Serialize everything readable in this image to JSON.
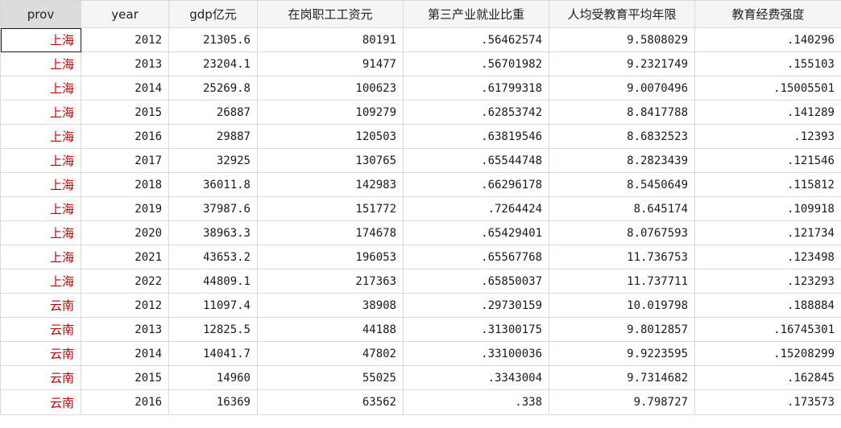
{
  "columns": [
    "prov",
    "year",
    "gdp亿元",
    "在岗职工工资元",
    "第三产业就业比重",
    "人均受教育平均年限",
    "教育经费强度"
  ],
  "rows": [
    [
      "上海",
      "2012",
      "21305.6",
      "80191",
      ".56462574",
      "9.5808029",
      ".140296"
    ],
    [
      "上海",
      "2013",
      "23204.1",
      "91477",
      ".56701982",
      "9.2321749",
      ".155103"
    ],
    [
      "上海",
      "2014",
      "25269.8",
      "100623",
      ".61799318",
      "9.0070496",
      ".15005501"
    ],
    [
      "上海",
      "2015",
      "26887",
      "109279",
      ".62853742",
      "8.8417788",
      ".141289"
    ],
    [
      "上海",
      "2016",
      "29887",
      "120503",
      ".63819546",
      "8.6832523",
      ".12393"
    ],
    [
      "上海",
      "2017",
      "32925",
      "130765",
      ".65544748",
      "8.2823439",
      ".121546"
    ],
    [
      "上海",
      "2018",
      "36011.8",
      "142983",
      ".66296178",
      "8.5450649",
      ".115812"
    ],
    [
      "上海",
      "2019",
      "37987.6",
      "151772",
      ".7264424",
      "8.645174",
      ".109918"
    ],
    [
      "上海",
      "2020",
      "38963.3",
      "174678",
      ".65429401",
      "8.0767593",
      ".121734"
    ],
    [
      "上海",
      "2021",
      "43653.2",
      "196053",
      ".65567768",
      "11.736753",
      ".123498"
    ],
    [
      "上海",
      "2022",
      "44809.1",
      "217363",
      ".65850037",
      "11.737711",
      ".123293"
    ],
    [
      "云南",
      "2012",
      "11097.4",
      "38908",
      ".29730159",
      "10.019798",
      ".188884"
    ],
    [
      "云南",
      "2013",
      "12825.5",
      "44188",
      ".31300175",
      "9.8012857",
      ".16745301"
    ],
    [
      "云南",
      "2014",
      "14041.7",
      "47802",
      ".33100036",
      "9.9223595",
      ".15208299"
    ],
    [
      "云南",
      "2015",
      "14960",
      "55025",
      ".3343004",
      "9.7314682",
      ".162845"
    ],
    [
      "云南",
      "2016",
      "16369",
      "63562",
      ".338",
      "9.798727",
      ".173573"
    ]
  ],
  "selected_column": 0,
  "active_cell": [
    0,
    0
  ],
  "colors": {
    "string_text": "#c00000",
    "header_bg": "#f5f5f5",
    "selected_header_bg": "#dcdcdc",
    "grid_line": "#d9d9d9"
  }
}
